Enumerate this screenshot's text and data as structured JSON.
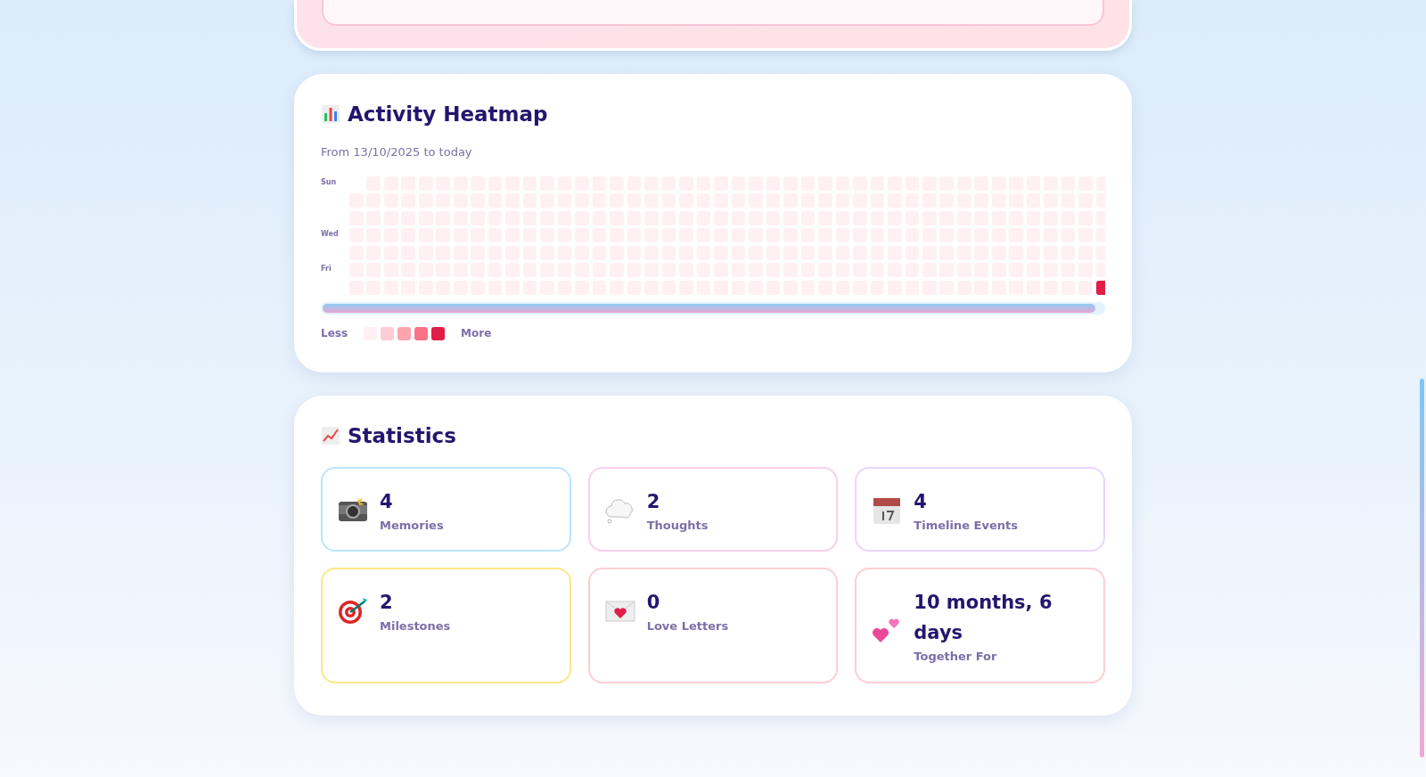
{
  "heatmap": {
    "title": "Activity Heatmap",
    "subtitle": "From 13/10/2025 to today",
    "day_labels": [
      "Sun",
      "Wed",
      "Fri"
    ],
    "today": {
      "color": "#e11d48"
    },
    "legend": {
      "less": "Less",
      "more": "More",
      "swatches": [
        {
          "color": "#fff1f3"
        },
        {
          "color": "#fecdd3"
        },
        {
          "color": "#fda4af"
        },
        {
          "color": "#fb7185"
        },
        {
          "color": "#e11d48"
        }
      ]
    }
  },
  "statistics": {
    "title": "Statistics",
    "cards": [
      {
        "kind": "camera",
        "value": "4",
        "label": "Memories",
        "color": "#bae6fd"
      },
      {
        "kind": "cloud",
        "value": "2",
        "label": "Thoughts",
        "color": "#fbcfe8"
      },
      {
        "kind": "calendar",
        "value": "4",
        "label": "Timeline Events",
        "color": "#e9d5ff"
      },
      {
        "kind": "target",
        "value": "2",
        "label": "Milestones",
        "color": "#fde68a"
      },
      {
        "kind": "envelope",
        "value": "0",
        "label": "Love Letters",
        "color": "#fecdd3"
      },
      {
        "kind": "hearts",
        "value": "10 months, 6 days",
        "label": "Together For",
        "color": "#fecdd3"
      }
    ]
  }
}
